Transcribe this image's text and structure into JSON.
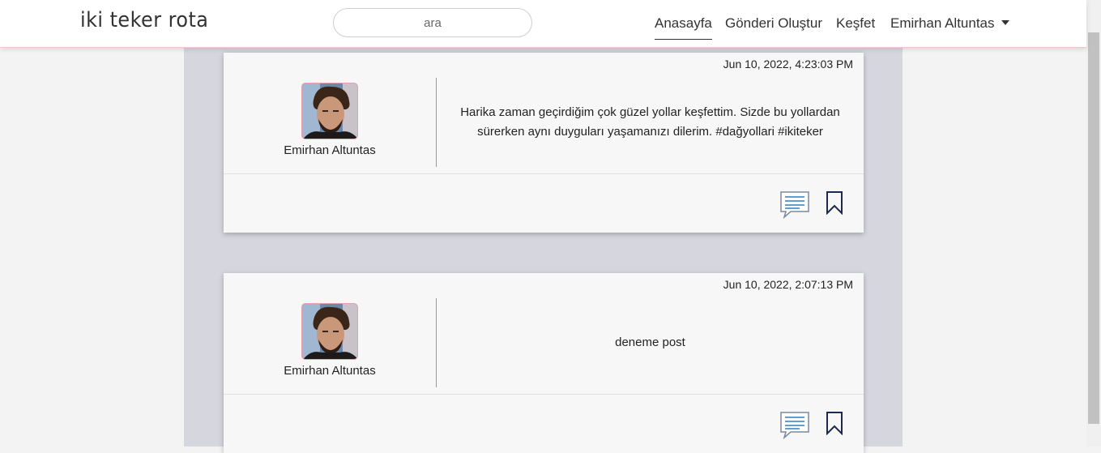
{
  "app": {
    "brand": "iki teker rota"
  },
  "header": {
    "search_placeholder": "ara",
    "nav": [
      {
        "label": "Anasayfa",
        "active": true
      },
      {
        "label": "Gönderi Oluştur"
      },
      {
        "label": "Keşfet"
      }
    ],
    "user_menu": {
      "label": "Emirhan Altuntas"
    }
  },
  "posts": [
    {
      "timestamp": "Jun 10, 2022, 4:23:03 PM",
      "author": "Emirhan Altuntas",
      "text": "Harika zaman geçirdiğim çok güzel yollar keşfettim. Sizde bu yollardan sürerken aynı duyguları yaşamanızı dilerim. #dağyollari #ikiteker"
    },
    {
      "timestamp": "Jun 10, 2022, 2:07:13 PM",
      "author": "Emirhan Altuntas",
      "text": "deneme post"
    }
  ],
  "icons": {
    "comment": "comment-icon",
    "bookmark": "bookmark-icon",
    "avatar": "avatar-photo"
  },
  "colors": {
    "accent_border": "#f0c9cf",
    "column_bg": "#d6d6de",
    "icon_blue": "#2f7fc0",
    "bookmark_navy": "#1f2a4a"
  }
}
